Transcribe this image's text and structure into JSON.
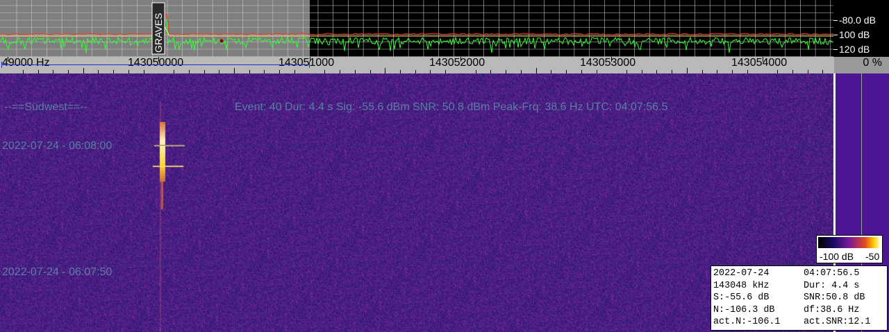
{
  "spectrum": {
    "db_scale": [
      "-80.0 dB",
      "100 dB",
      "120 dB"
    ],
    "marker_labels": [
      "GRAVES"
    ]
  },
  "ruler": {
    "freq_labels": [
      "49000 Hz",
      "143050000",
      "143051000",
      "143052000",
      "143053000",
      "143054000"
    ],
    "percent": "0 %"
  },
  "waterfall": {
    "station": "--==Südwest==--",
    "event": "Event: 40   Dur: 4.4 s   Sig: -55.6 dBm   SNR: 50.8 dBm   Peak-Frq: 38.6 Hz   UTC: 04:07:56.5",
    "time_labels": [
      "2022-07-24 - 06:08:00",
      "2022-07-24 - 06:07:50"
    ]
  },
  "legend": {
    "low": "-100 dB",
    "high": "-50"
  },
  "info": {
    "rows": [
      [
        "2022-07-24",
        "04:07:56.5"
      ],
      [
        "143048 kHz",
        "Dur: 4.4 s"
      ],
      [
        "S:-55.6 dB",
        "SNR:50.8 dB"
      ],
      [
        "N:-106.3 dB",
        "df:38.6 Hz"
      ],
      [
        "act.N:-106.1",
        "act.SNR:12.1"
      ]
    ]
  },
  "colors": {
    "spectrum_trace": "#33ff33",
    "average_trace": "#ff2a2a",
    "waterfall_bg": "#2a1a7a",
    "meteor": "#ffd530",
    "side_bar": "#4e1496"
  }
}
